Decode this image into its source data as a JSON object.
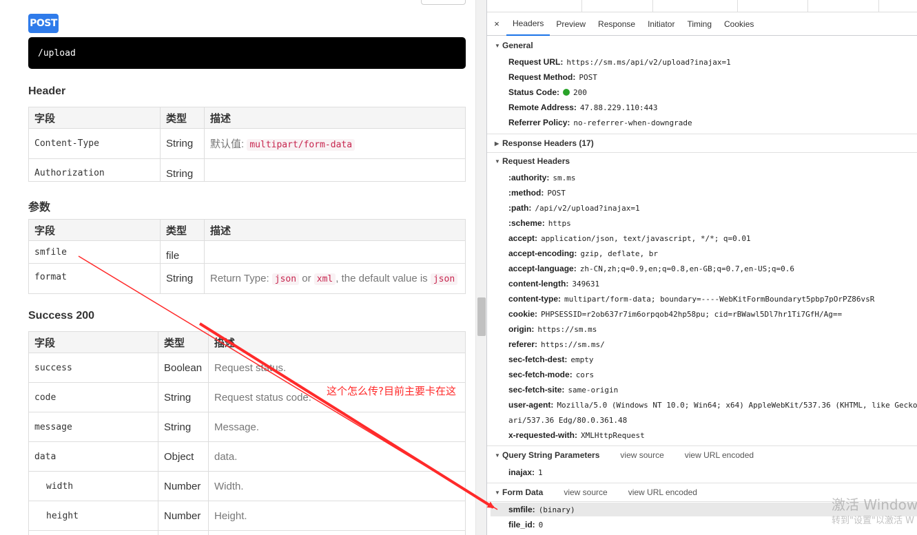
{
  "left": {
    "method_badge": "POST",
    "endpoint_path": "/upload",
    "header_title": "Header",
    "params_title": "参数",
    "success_title": "Success 200",
    "col_field": "字段",
    "col_type": "类型",
    "col_desc": "描述",
    "header_rows": [
      {
        "field": "Content-Type",
        "type": "String",
        "desc_prefix": "默认值: ",
        "desc_code": "multipart/form-data"
      },
      {
        "field": "Authorization",
        "type": "String"
      }
    ],
    "param_rows": [
      {
        "field": "smfile",
        "type": "file",
        "desc": ""
      },
      {
        "field": "format",
        "type": "String",
        "desc_a": "Return Type: ",
        "code1": "json",
        "desc_b": " or ",
        "code2": "xml",
        "desc_c": ", the default value is ",
        "code3": "json"
      }
    ],
    "success_rows": [
      {
        "field": "success",
        "type": "Boolean",
        "desc": "Request status."
      },
      {
        "field": "code",
        "type": "String",
        "desc": "Request status code."
      },
      {
        "field": "message",
        "type": "String",
        "desc": "Message."
      },
      {
        "field": "data",
        "type": "Object",
        "desc": "data."
      },
      {
        "field": "width",
        "type": "Number",
        "desc": "Width."
      },
      {
        "field": "height",
        "type": "Number",
        "desc": "Height."
      }
    ]
  },
  "annotation": {
    "text": "这个怎么传?目前主要卡在这",
    "color": "#ff2a2a"
  },
  "devtools": {
    "tabs": [
      "Headers",
      "Preview",
      "Response",
      "Initiator",
      "Timing",
      "Cookies"
    ],
    "active_tab": "Headers",
    "close_glyph": "×",
    "general": {
      "title": "General",
      "rows": [
        {
          "k": "Request URL:",
          "v": "https://sm.ms/api/v2/upload?inajax=1"
        },
        {
          "k": "Request Method:",
          "v": "POST"
        },
        {
          "k": "Status Code:",
          "v": "200"
        },
        {
          "k": "Remote Address:",
          "v": "47.88.229.110:443"
        },
        {
          "k": "Referrer Policy:",
          "v": "no-referrer-when-downgrade"
        }
      ]
    },
    "response_headers_title": "Response Headers (17)",
    "request_headers": {
      "title": "Request Headers",
      "rows": [
        {
          "k": ":authority:",
          "v": "sm.ms"
        },
        {
          "k": ":method:",
          "v": "POST"
        },
        {
          "k": ":path:",
          "v": "/api/v2/upload?inajax=1"
        },
        {
          "k": ":scheme:",
          "v": "https"
        },
        {
          "k": "accept:",
          "v": "application/json, text/javascript, */*; q=0.01"
        },
        {
          "k": "accept-encoding:",
          "v": "gzip, deflate, br"
        },
        {
          "k": "accept-language:",
          "v": "zh-CN,zh;q=0.9,en;q=0.8,en-GB;q=0.7,en-US;q=0.6"
        },
        {
          "k": "content-length:",
          "v": "349631"
        },
        {
          "k": "content-type:",
          "v": "multipart/form-data; boundary=----WebKitFormBoundaryt5pbp7pOrPZ86vsR"
        },
        {
          "k": "cookie:",
          "v": "PHPSESSID=r2ob637r7im6orpqob42hp58pu; cid=rBWawl5Dl7hr1Ti7GfH/Ag=="
        },
        {
          "k": "origin:",
          "v": "https://sm.ms"
        },
        {
          "k": "referer:",
          "v": "https://sm.ms/"
        },
        {
          "k": "sec-fetch-dest:",
          "v": "empty"
        },
        {
          "k": "sec-fetch-mode:",
          "v": "cors"
        },
        {
          "k": "sec-fetch-site:",
          "v": "same-origin"
        },
        {
          "k": "user-agent:",
          "v": "Mozilla/5.0 (Windows NT 10.0; Win64; x64) AppleWebKit/537.36 (KHTML, like Gecko)"
        },
        {
          "k": "",
          "v": "ari/537.36 Edg/80.0.361.48"
        },
        {
          "k": "x-requested-with:",
          "v": "XMLHttpRequest"
        }
      ]
    },
    "query_params": {
      "title": "Query String Parameters",
      "view_source": "view source",
      "view_url": "view URL encoded",
      "rows": [
        {
          "k": "inajax:",
          "v": "1"
        }
      ]
    },
    "form_data": {
      "title": "Form Data",
      "view_source": "view source",
      "view_url": "view URL encoded",
      "rows": [
        {
          "k": "smfile:",
          "v": "(binary)"
        },
        {
          "k": "file_id:",
          "v": "0"
        }
      ]
    },
    "status_dot_color": "#29a329"
  },
  "watermark": {
    "line1": "激活 Windows",
    "line2": "转到\"设置\"以激活 W"
  }
}
